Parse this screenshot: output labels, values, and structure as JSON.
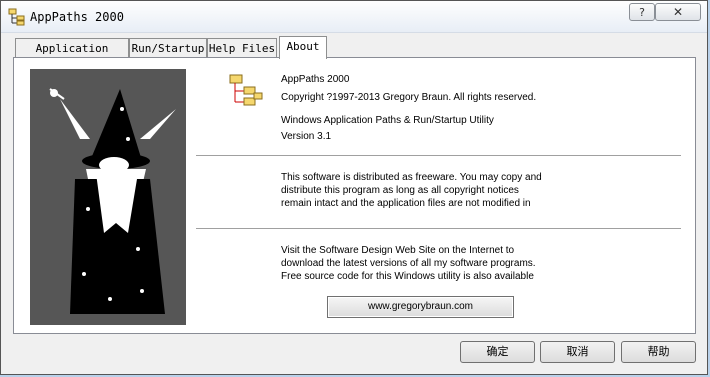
{
  "window": {
    "title": "AppPaths 2000",
    "help_button": "?",
    "close_button": "✕"
  },
  "tabs": [
    {
      "label": "Application Paths"
    },
    {
      "label": "Run/Startup"
    },
    {
      "label": "Help Files"
    },
    {
      "label": "About",
      "active": true
    }
  ],
  "about": {
    "app_name": "AppPaths 2000",
    "copyright": "Copyright ?1997-2013 Gregory Braun. All rights reserved.",
    "description": "Windows Application Paths & Run/Startup Utility",
    "version": "Version 3.1",
    "freeware_lines": [
      "This software is distributed as freeware. You may copy and",
      "distribute this program as long as all copyright notices",
      "remain intact and the application files are not modified in"
    ],
    "website_lines": [
      "Visit the Software Design Web Site on the Internet to",
      "download the latest versions of all my software programs.",
      "Free source code for this Windows utility is also available"
    ],
    "website_button": "www.gregorybraun.com"
  },
  "buttons": {
    "ok": "确定",
    "cancel": "取消",
    "help": "帮助"
  }
}
